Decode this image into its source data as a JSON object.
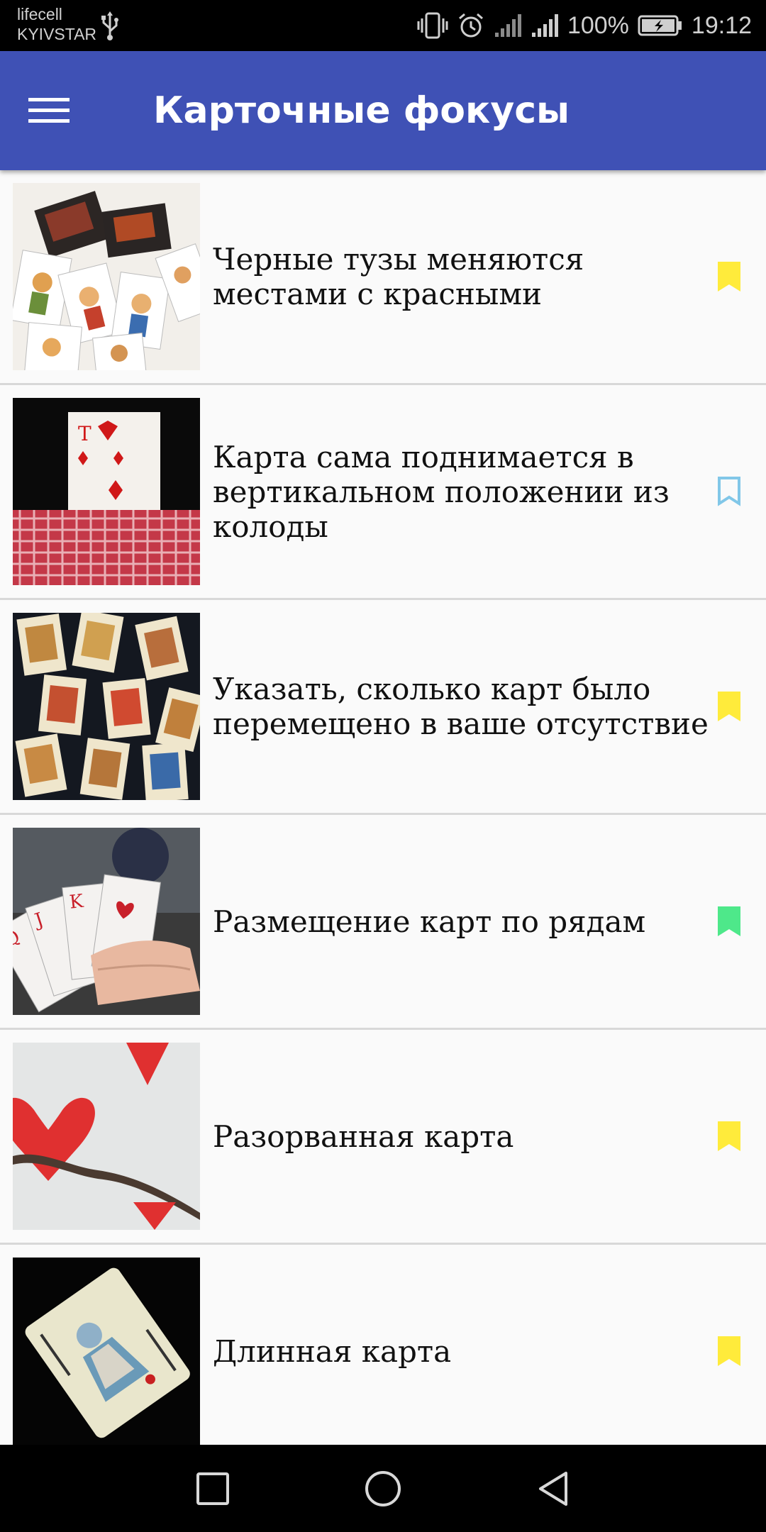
{
  "status_bar": {
    "carrier_1": "lifecell",
    "carrier_2": "KYIVSTAR",
    "battery_percent": "100%",
    "time": "19:12"
  },
  "app_bar": {
    "title": "Карточные фокусы"
  },
  "list": {
    "items": [
      {
        "title": "Черные тузы меняются местами с красными",
        "bookmark_state": "filled",
        "bookmark_color": "#ffeb3b"
      },
      {
        "title": "Карта сама поднимается в вертикальном положении из колоды",
        "bookmark_state": "outline",
        "bookmark_color": "#81c7e8"
      },
      {
        "title": "Указать, сколько карт было перемещено в ваше отсутствие",
        "bookmark_state": "filled",
        "bookmark_color": "#ffeb3b"
      },
      {
        "title": "Размещение карт по рядам",
        "bookmark_state": "filled",
        "bookmark_color": "#4ee88a"
      },
      {
        "title": "Разорванная карта",
        "bookmark_state": "filled",
        "bookmark_color": "#ffeb3b"
      },
      {
        "title": "Длинная карта",
        "bookmark_state": "filled",
        "bookmark_color": "#ffeb3b"
      }
    ]
  },
  "colors": {
    "app_bar": "#3f51b5",
    "background": "#fafafa",
    "divider": "#d8d8d8"
  }
}
